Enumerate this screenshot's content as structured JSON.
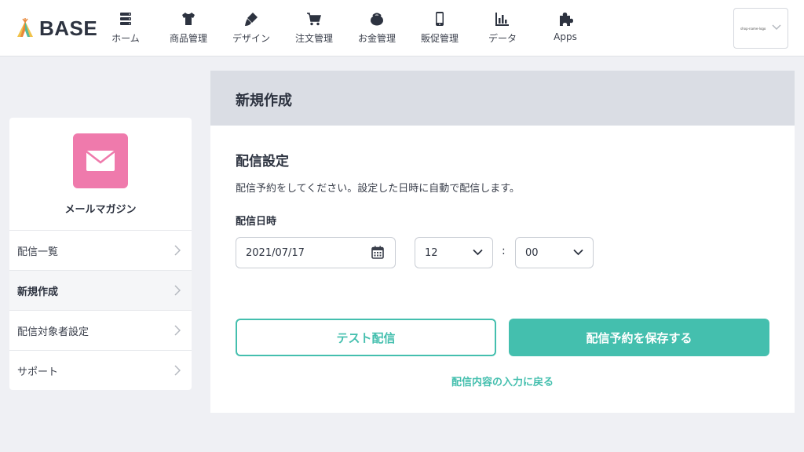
{
  "header": {
    "brand": "BASE",
    "nav": [
      {
        "label": "ホーム",
        "icon": "home-icon"
      },
      {
        "label": "商品管理",
        "icon": "tshirt-icon"
      },
      {
        "label": "デザイン",
        "icon": "brush-icon"
      },
      {
        "label": "注文管理",
        "icon": "cart-icon"
      },
      {
        "label": "お金管理",
        "icon": "wallet-icon"
      },
      {
        "label": "販促管理",
        "icon": "smartphone-icon"
      },
      {
        "label": "データ",
        "icon": "bar-chart-icon"
      },
      {
        "label": "Apps",
        "icon": "puzzle-icon"
      }
    ],
    "shop_logo_text": "shop-name-logo"
  },
  "sidebar": {
    "app_title": "メールマガジン",
    "app_icon": "envelope-icon",
    "items": [
      {
        "label": "配信一覧"
      },
      {
        "label": "新規作成"
      },
      {
        "label": "配信対象者設定"
      },
      {
        "label": "サポート"
      }
    ]
  },
  "main": {
    "page_title": "新規作成",
    "section_title": "配信設定",
    "description": "配信予約をしてください。設定した日時に自動で配信します。",
    "datetime_label": "配信日時",
    "date_value": "2021/07/17",
    "hour_value": "12",
    "minute_value": "00",
    "separator": ":",
    "test_button": "テスト配信",
    "save_button": "配信予約を保存する",
    "back_link": "配信内容の入力に戻る"
  },
  "colors": {
    "accent": "#44bfae",
    "app_icon_bg": "#ef7aac",
    "page_bg": "#eff0f4",
    "page_head_bg": "#dadde4"
  }
}
